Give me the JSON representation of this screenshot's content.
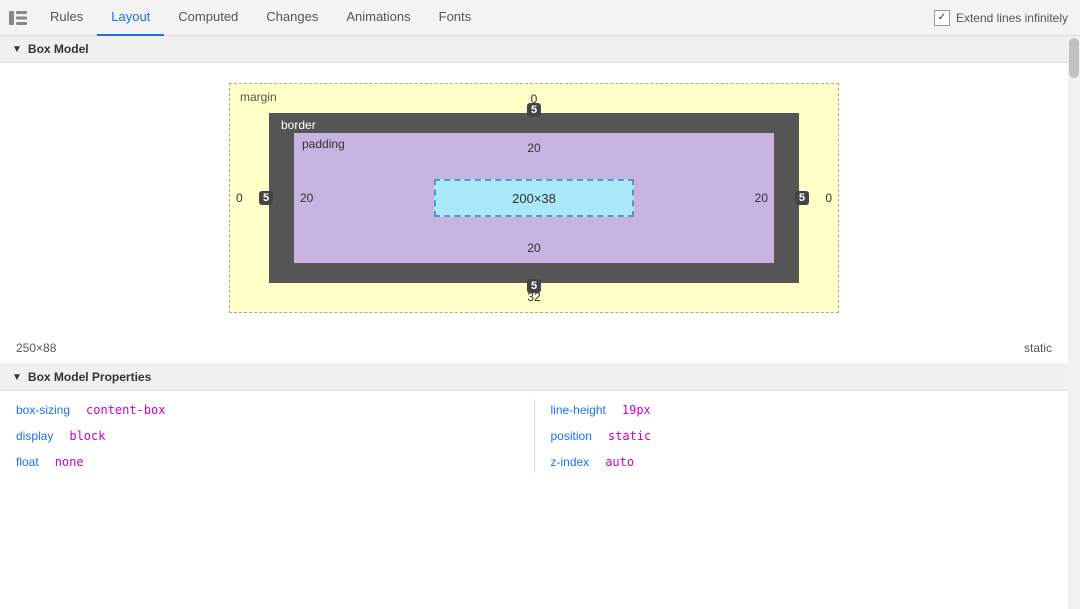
{
  "tabs": [
    {
      "id": "rules",
      "label": "Rules",
      "active": false
    },
    {
      "id": "layout",
      "label": "Layout",
      "active": true
    },
    {
      "id": "computed",
      "label": "Computed",
      "active": false
    },
    {
      "id": "changes",
      "label": "Changes",
      "active": false
    },
    {
      "id": "animations",
      "label": "Animations",
      "active": false
    },
    {
      "id": "fonts",
      "label": "Fonts",
      "active": false
    }
  ],
  "extend_lines": {
    "label": "Extend lines infinitely",
    "checked": true
  },
  "box_model_section": {
    "title": "Box Model",
    "margin": {
      "label": "margin",
      "top": "0",
      "right": "0",
      "bottom": "32",
      "left": "0"
    },
    "border": {
      "label": "border",
      "top": "5",
      "right": "5",
      "bottom": "5",
      "left": "5"
    },
    "padding": {
      "label": "padding",
      "top": "20",
      "right": "20",
      "bottom": "20",
      "left": "20"
    },
    "content": {
      "width": "200",
      "height": "38",
      "label": "200×38"
    }
  },
  "element_size": {
    "label": "250×88",
    "position": "static"
  },
  "box_model_properties": {
    "title": "Box Model Properties",
    "left_col": [
      {
        "name": "box-sizing",
        "value": "content-box"
      },
      {
        "name": "display",
        "value": "block"
      },
      {
        "name": "float",
        "value": "none"
      }
    ],
    "right_col": [
      {
        "name": "line-height",
        "value": "19px"
      },
      {
        "name": "position",
        "value": "static"
      },
      {
        "name": "z-index",
        "value": "auto"
      }
    ]
  }
}
